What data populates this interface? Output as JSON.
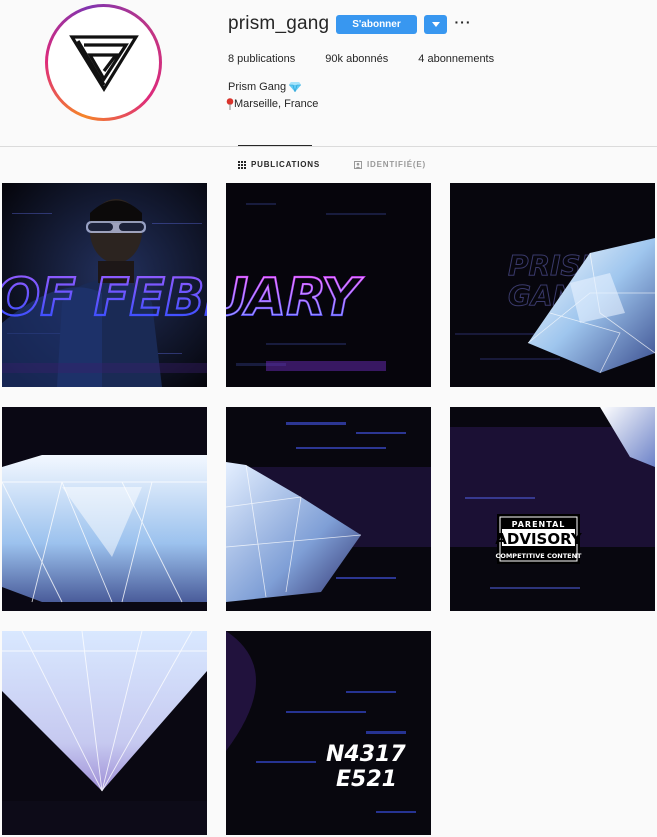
{
  "profile": {
    "username": "prism_gang",
    "follow_label": "S'abonner",
    "dropdown_icon": "chevron-down-icon",
    "more_icon": "ellipsis-icon",
    "more_label": "···",
    "stats": {
      "publications": "8 publications",
      "followers": "90k abonnés",
      "following": "4 abonnements"
    },
    "full_name": "Prism Gang",
    "full_name_emoji": "diamond-emoji",
    "location_pin_icon": "pin-icon",
    "location": "Marseille, France"
  },
  "tabs": {
    "posts": "PUBLICATIONS",
    "tagged": "IDENTIFIÉ(E)"
  },
  "posts": [
    {
      "overlay_text": "OF FEBRUARY"
    },
    {
      "overlay_text": "OF FEBRUARY"
    },
    {
      "overlay_text": "PRISM GANG"
    },
    {
      "overlay_text": ""
    },
    {
      "overlay_text": ""
    },
    {
      "advisory_top": "PARENTAL",
      "advisory_main": "ADVISORY",
      "advisory_bottom": "COMPETITIVE CONTENT"
    },
    {
      "overlay_text": ""
    },
    {
      "code_line1": "N4317",
      "code_line2": "E521"
    }
  ],
  "colors": {
    "accent": "#3897f0",
    "neon_pink": "#e63cff",
    "neon_blue": "#4a7dff",
    "tile_bg": "#07060d"
  }
}
